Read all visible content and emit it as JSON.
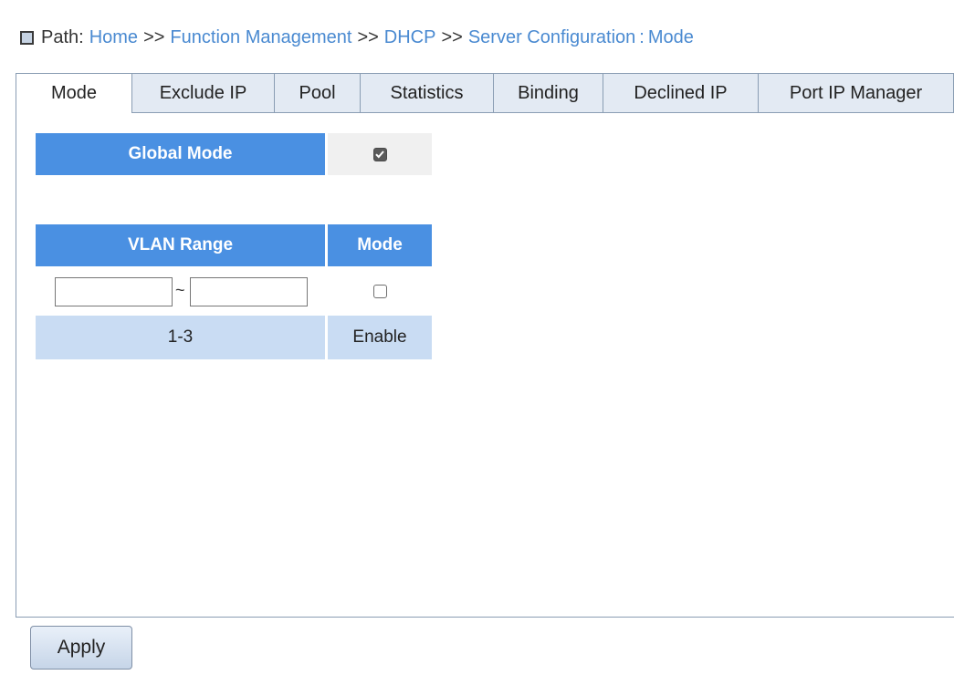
{
  "path": {
    "label": "Path:",
    "crumbs": [
      "Home",
      "Function Management",
      "DHCP",
      "Server Configuration"
    ],
    "separator": ">>",
    "colon": ":",
    "current": "Mode"
  },
  "tabs": [
    {
      "label": "Mode",
      "active": true
    },
    {
      "label": "Exclude IP",
      "active": false
    },
    {
      "label": "Pool",
      "active": false
    },
    {
      "label": "Statistics",
      "active": false
    },
    {
      "label": "Binding",
      "active": false
    },
    {
      "label": "Declined IP",
      "active": false
    },
    {
      "label": "Port IP Manager",
      "active": false
    }
  ],
  "global_mode": {
    "label": "Global Mode",
    "checked": true
  },
  "vlan_table": {
    "headers": {
      "range": "VLAN Range",
      "mode": "Mode"
    },
    "input": {
      "from_value": "",
      "to_value": "",
      "tilde": "~",
      "mode_checked": false
    },
    "rows": [
      {
        "range": "1-3",
        "mode": "Enable"
      }
    ]
  },
  "apply_label": "Apply",
  "colors": {
    "header_blue": "#4a90e2",
    "row_light_blue": "#c9dcf3",
    "link_blue": "#4a8ad1",
    "tab_border": "#8a9db3"
  }
}
